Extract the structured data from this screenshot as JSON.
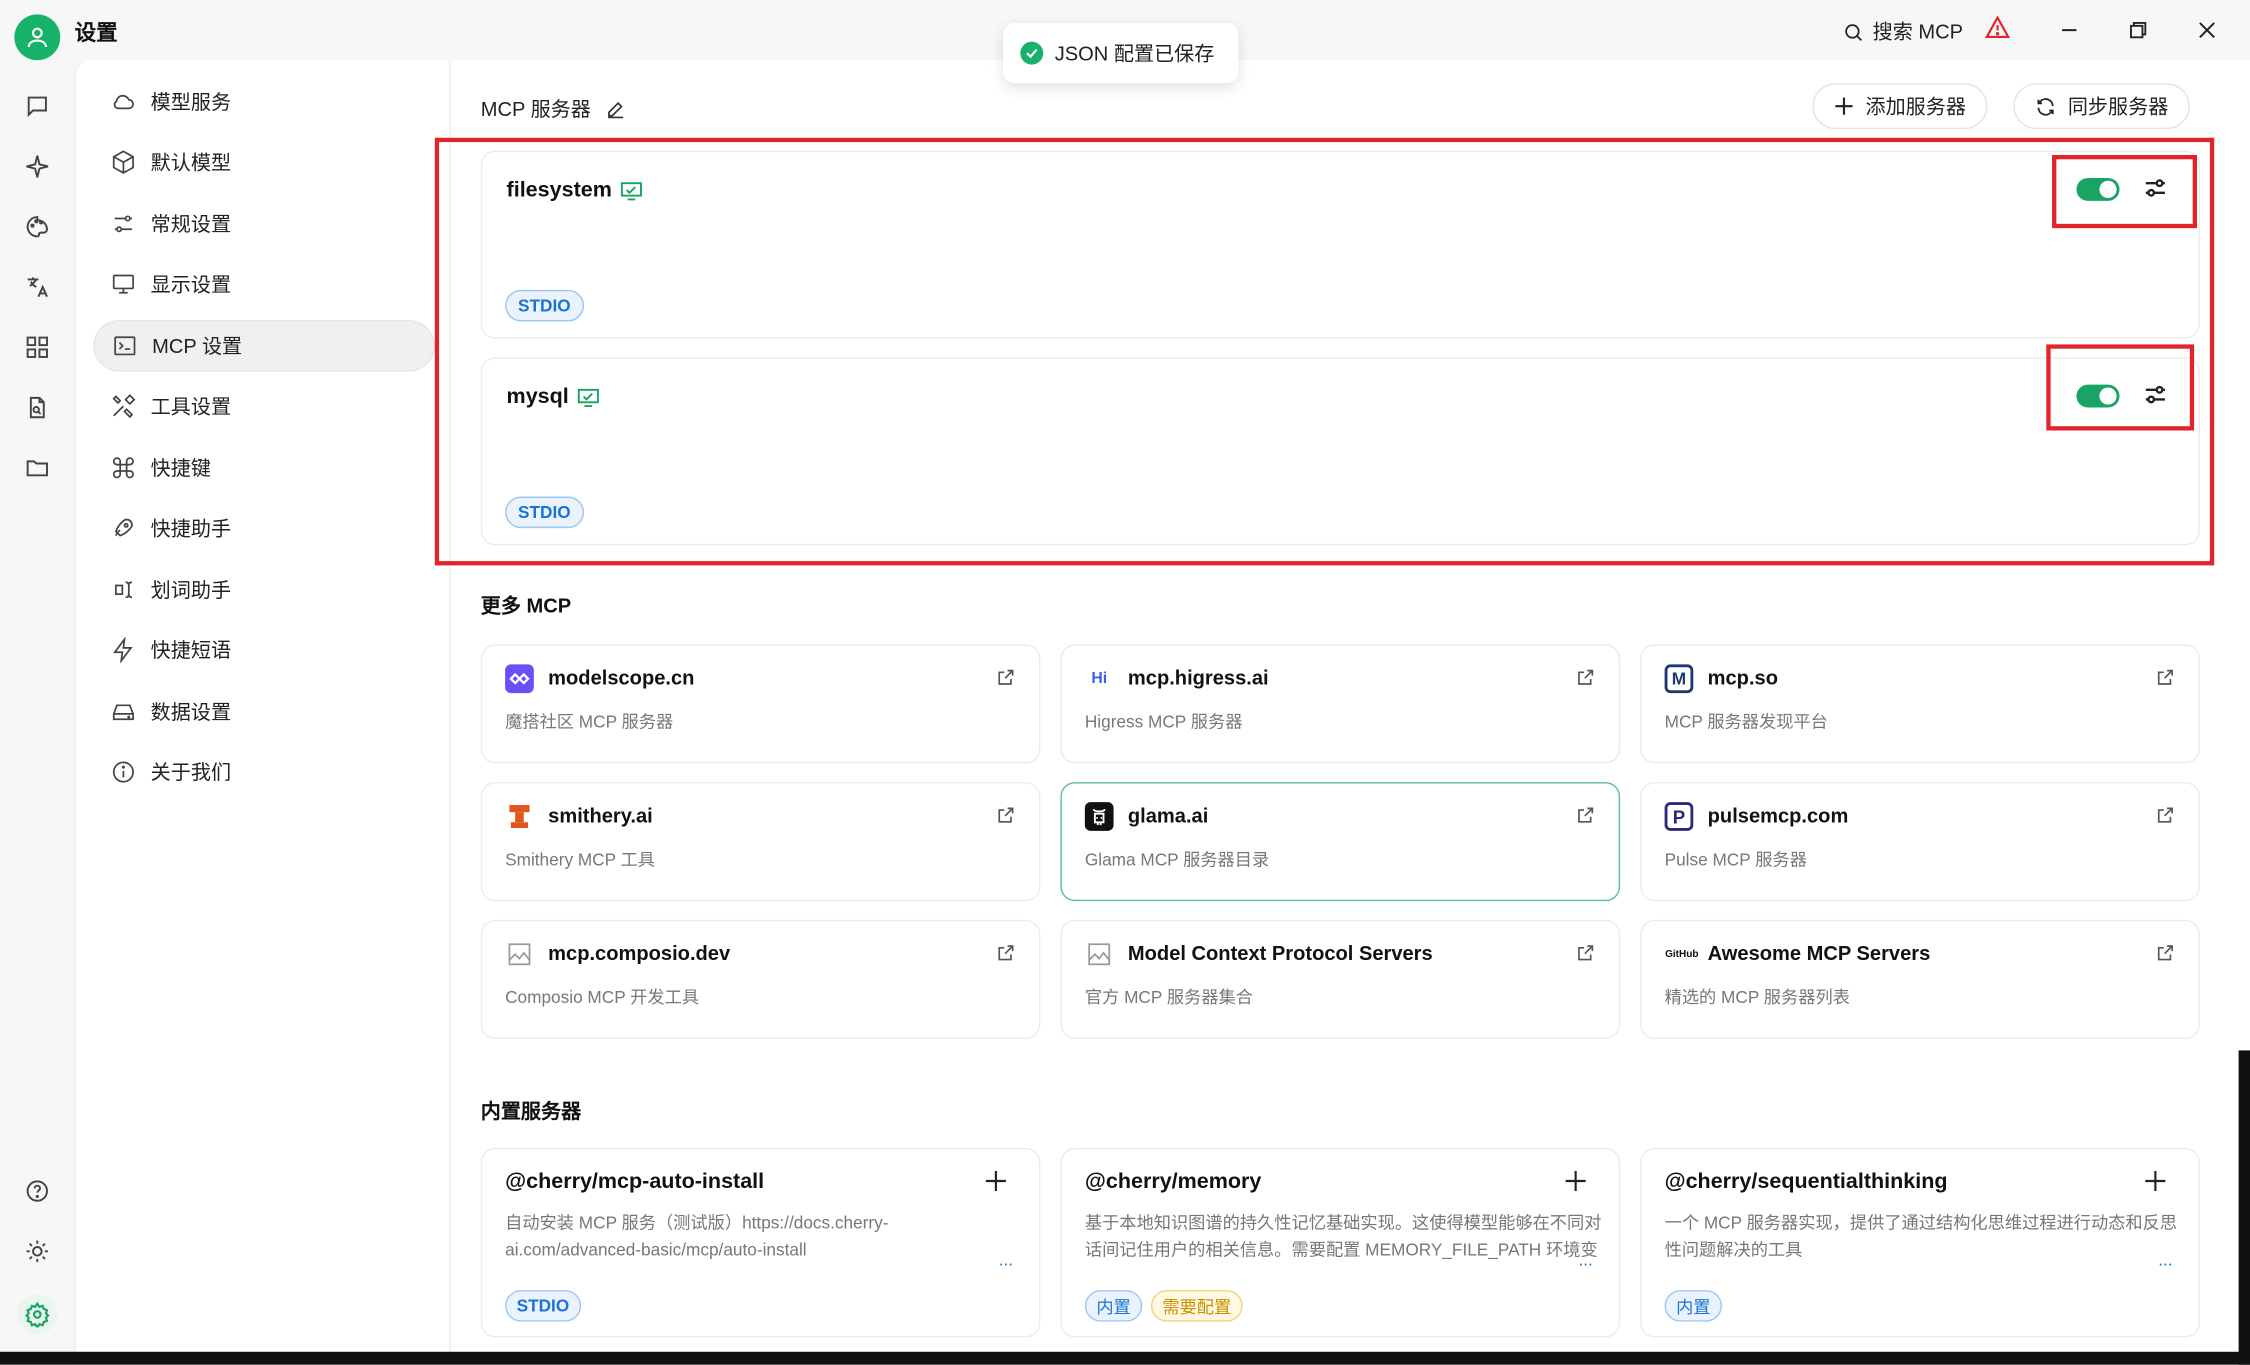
{
  "window": {
    "title": "设置",
    "search_label": "搜索 MCP"
  },
  "toast": {
    "text": "JSON 配置已保存"
  },
  "menu": {
    "items": [
      {
        "label": "模型服务",
        "icon": "cloud-icon"
      },
      {
        "label": "默认模型",
        "icon": "cube-icon"
      },
      {
        "label": "常规设置",
        "icon": "sliders-icon"
      },
      {
        "label": "显示设置",
        "icon": "monitor-icon"
      },
      {
        "label": "MCP 设置",
        "icon": "terminal-icon",
        "active": true
      },
      {
        "label": "工具设置",
        "icon": "tools-icon"
      },
      {
        "label": "快捷键",
        "icon": "command-icon"
      },
      {
        "label": "快捷助手",
        "icon": "rocket-icon"
      },
      {
        "label": "划词助手",
        "icon": "text-cursor-icon"
      },
      {
        "label": "快捷短语",
        "icon": "zap-icon"
      },
      {
        "label": "数据设置",
        "icon": "hard-drive-icon"
      },
      {
        "label": "关于我们",
        "icon": "info-icon"
      }
    ]
  },
  "main": {
    "title": "MCP 服务器",
    "add_button": "添加服务器",
    "sync_button": "同步服务器",
    "servers": [
      {
        "name": "filesystem",
        "type": "STDIO",
        "enabled": true
      },
      {
        "name": "mysql",
        "type": "STDIO",
        "enabled": true
      }
    ],
    "more_title": "更多 MCP",
    "links": [
      {
        "name": "modelscope.cn",
        "desc": "魔搭社区 MCP 服务器"
      },
      {
        "name": "mcp.higress.ai",
        "desc": "Higress MCP 服务器"
      },
      {
        "name": "mcp.so",
        "desc": "MCP 服务器发现平台"
      },
      {
        "name": "smithery.ai",
        "desc": "Smithery MCP 工具"
      },
      {
        "name": "glama.ai",
        "desc": "Glama MCP 服务器目录"
      },
      {
        "name": "pulsemcp.com",
        "desc": "Pulse MCP 服务器"
      },
      {
        "name": "mcp.composio.dev",
        "desc": "Composio MCP 开发工具"
      },
      {
        "name": "Model Context Protocol Servers",
        "desc": "官方 MCP 服务器集合"
      },
      {
        "name": "Awesome MCP Servers",
        "desc": "精选的 MCP 服务器列表"
      }
    ],
    "logo_text": {
      "higress": "Hi",
      "mcpso": "M",
      "pulse": "P",
      "github": "GitHub"
    },
    "builtin_title": "内置服务器",
    "builtins": [
      {
        "name": "@cherry/mcp-auto-install",
        "desc": "自动安装 MCP 服务（测试版）https://docs.cherry-ai.com/advanced-basic/mcp/auto-install",
        "tags": [
          "STDIO"
        ]
      },
      {
        "name": "@cherry/memory",
        "desc": "基于本地知识图谱的持久性记忆基础实现。这使得模型能够在不同对话间记住用户的相关信息。需要配置 MEMORY_FILE_PATH 环境变量",
        "tags": [
          "内置",
          "需要配置"
        ]
      },
      {
        "name": "@cherry/sequentialthinking",
        "desc": "一个 MCP 服务器实现，提供了通过结构化思维过程进行动态和反思性问题解决的工具",
        "tags": [
          "内置"
        ]
      }
    ],
    "more_dots": "..."
  },
  "colors": {
    "accent": "#19b26b",
    "toggle_on": "#19a463",
    "highlight_box": "#e0242a",
    "tag_blue": "#1b74d1",
    "tag_orange": "#c89000"
  }
}
